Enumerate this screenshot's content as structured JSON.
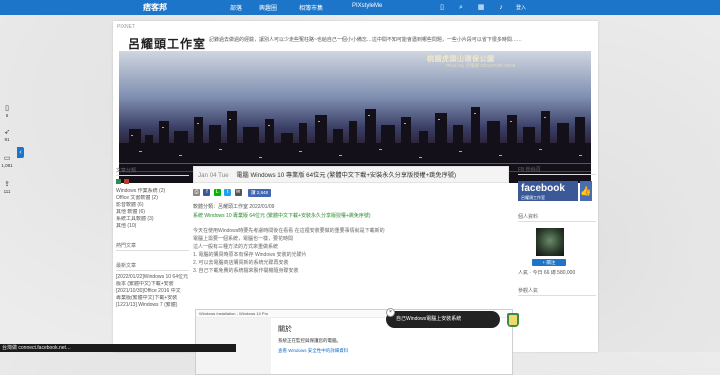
{
  "topbar": {
    "logo": "痞客邦",
    "nav": [
      "部落",
      "興趣圈",
      "相簿市集",
      "PIXstyleMe"
    ],
    "login": "登入"
  },
  "side_float": [
    {
      "icon": "bookmark-icon",
      "count": "6"
    },
    {
      "icon": "rocket-icon",
      "count": "91"
    },
    {
      "icon": "comment-icon",
      "count": "1,081"
    },
    {
      "icon": "share-icon",
      "count": "111"
    }
  ],
  "header": {
    "breadcrumb": "PIXNET",
    "blog_title": "呂耀頭工作室",
    "description": "記錄過去做過的經驗，讓別人可以少走些冤枉路~也給自己一個小小備忘…這中間不知可能會遇到哪些問題，一些小片段可以省下很多時間……"
  },
  "banner": {
    "caption": "桃園虎頭山環保公園",
    "credit": "Photo By 呂耀頭 2021/07/30 19:00"
  },
  "left": {
    "section1_title": "文章分類",
    "categories": [
      "Windows 作業系統 (2)",
      "Office 文書軟體 (2)",
      "影音軟體 (6)",
      "其他 軟體 (6)",
      "系統工具軟體 (3)",
      "其他 (10)"
    ],
    "section2_title": "熱門文章",
    "section3_title": "最新文章",
    "recent": [
      "[2022/01/22]Windows 10 64位元",
      "版本 (繁體中文)下載+安裝",
      "[2021/10/30]Office 2016 中文",
      "專業版(繁體中文)下載+安裝",
      "[1221/13] Windows 7 (繁體)"
    ]
  },
  "post": {
    "date": "Jan 04 Tue",
    "title": "電腦 Windows 10 專業版 64位元 (繁體中文下載+安裝永久分享版授權+跳免序號)",
    "like_label": "讚 2,848",
    "meta": "軟體分類：呂耀頭工作室 2022/01/09",
    "link": "系統 Windows 10 專業版 64位元 (繁體中文下載+安裝永久分享版授權+跳免序號)",
    "body": [
      "今天在使用Windows時要先考慮時間後在看看 在這裡安裝要做的重要事情就是下載新的",
      "電腦上需要一個系統，電腦也一樣，要花時間",
      "這人一般有三種方法的方式來重做系統",
      "1. 電腦的購買時原本有保存 Windows 安裝的光碟片",
      "2. 可以去電腦商店購買新的系統光碟再安裝",
      "3. 自己下載免費的系統檔來製作開機隨身碟安裝"
    ]
  },
  "screenshot": {
    "bar_text": "Windows Installation - Windows 10 Pro",
    "title": "關於",
    "line1": "系統正在監控與保護您的電腦。",
    "line2": "查看 Windows 安全性中的詳細資料"
  },
  "right": {
    "fb_title": "FB 粉絲頁",
    "fb_word": "facebook",
    "fb_sub": "呂耀頭工作室",
    "author_title": "個人資料",
    "follow": "+ 關注",
    "visits": "人氣 · 今日 66 總 580,000",
    "side_title": "參觀人氣"
  },
  "toast": {
    "text": "自己Windows電腦上安裝系統"
  },
  "status_bar": "台灣做 connect.facebook.net…",
  "colors": {
    "topbar": "#1c75c8",
    "facebook": "#3b5998",
    "link": "#2a8a2a"
  }
}
